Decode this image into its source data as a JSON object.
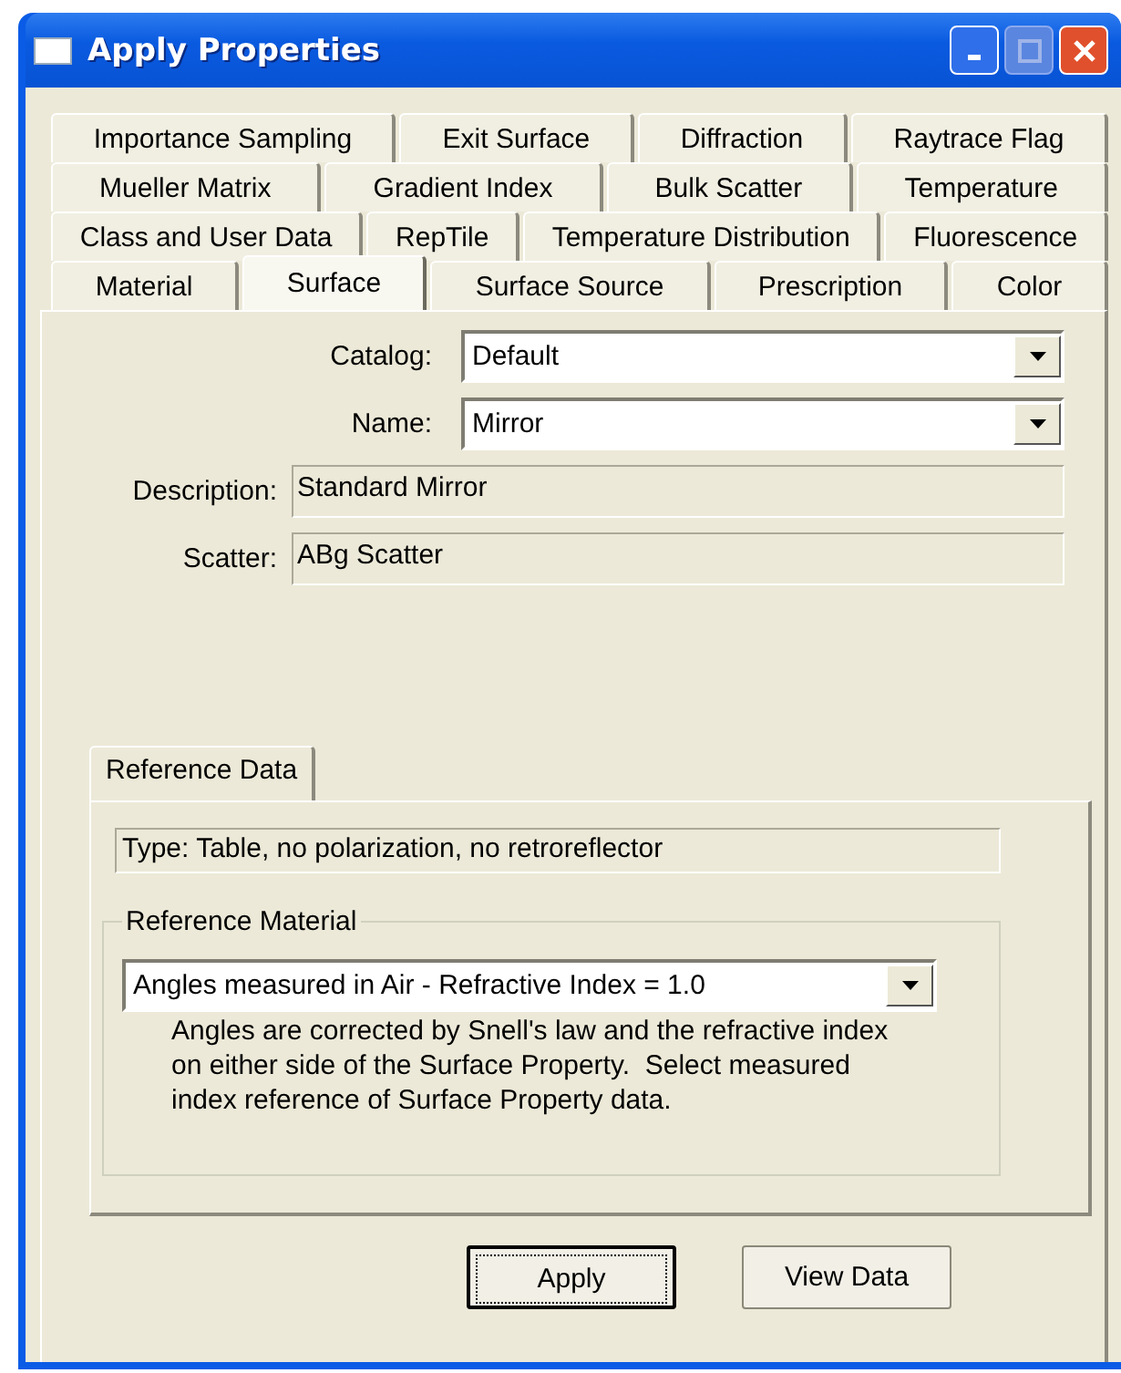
{
  "window": {
    "title": "Apply Properties"
  },
  "tab_rows": [
    [
      {
        "label": "Importance Sampling",
        "selected": false
      },
      {
        "label": "Exit Surface",
        "selected": false
      },
      {
        "label": "Diffraction",
        "selected": false
      },
      {
        "label": "Raytrace Flag",
        "selected": false
      }
    ],
    [
      {
        "label": "Mueller Matrix",
        "selected": false
      },
      {
        "label": "Gradient Index",
        "selected": false
      },
      {
        "label": "Bulk Scatter",
        "selected": false
      },
      {
        "label": "Temperature",
        "selected": false
      }
    ],
    [
      {
        "label": "Class and User Data",
        "selected": false
      },
      {
        "label": "RepTile",
        "selected": false
      },
      {
        "label": "Temperature Distribution",
        "selected": false
      },
      {
        "label": "Fluorescence",
        "selected": false
      }
    ],
    [
      {
        "label": "Material",
        "selected": false
      },
      {
        "label": "Surface",
        "selected": true
      },
      {
        "label": "Surface Source",
        "selected": false
      },
      {
        "label": "Prescription",
        "selected": false
      },
      {
        "label": "Color",
        "selected": false
      }
    ]
  ],
  "fields": [
    {
      "kind": "combo",
      "label": "Catalog:",
      "value": "Default"
    },
    {
      "kind": "combo",
      "label": "Name:",
      "value": "Mirror"
    },
    {
      "kind": "readonly",
      "label": "Description:",
      "value": "Standard Mirror"
    },
    {
      "kind": "readonly",
      "label": "Scatter:",
      "value": "ABg Scatter"
    }
  ],
  "reference": {
    "tab": "Reference Data",
    "type": "Type: Table, no polarization, no retroreflector",
    "group_title": "Reference Material",
    "dropdown": "Angles measured in Air - Refractive Index = 1.0",
    "note": "Angles are corrected by Snell's law and the refractive index on either side of the Surface Property.  Select measured index reference of Surface Property data."
  },
  "buttons": [
    {
      "label": "Apply",
      "default": true
    },
    {
      "label": "View Data",
      "default": false
    }
  ]
}
